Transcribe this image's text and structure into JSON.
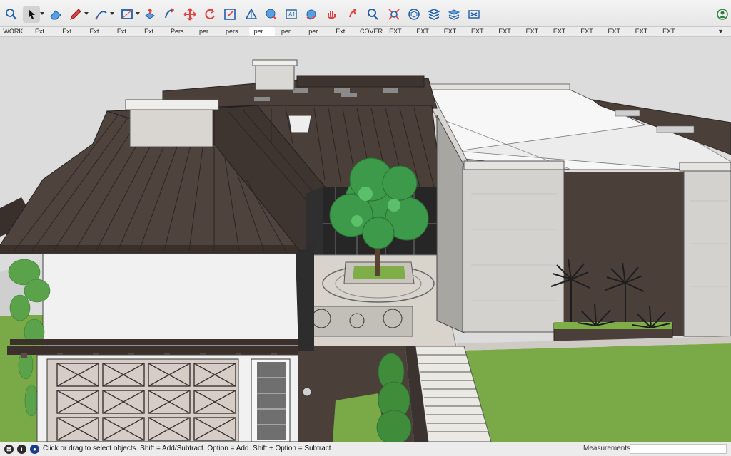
{
  "toolbar": {
    "tools": [
      {
        "name": "search-icon",
        "label": "Search"
      },
      {
        "name": "select-arrow-icon",
        "label": "Select",
        "active": true,
        "menu": true
      },
      {
        "name": "eraser-icon",
        "label": "Eraser"
      },
      {
        "name": "pencil-icon",
        "label": "Line",
        "menu": true
      },
      {
        "name": "arc-icon",
        "label": "Arc",
        "menu": true
      },
      {
        "name": "rectangle-icon",
        "label": "Rectangle",
        "menu": true
      },
      {
        "name": "push-pull-icon",
        "label": "Push/Pull"
      },
      {
        "name": "follow-me-icon",
        "label": "Follow Me"
      },
      {
        "name": "move-icon",
        "label": "Move"
      },
      {
        "name": "rotate-icon",
        "label": "Rotate"
      },
      {
        "name": "scale-icon",
        "label": "Scale"
      },
      {
        "name": "tape-measure-icon",
        "label": "Tape Measure"
      },
      {
        "name": "paint-bucket-icon",
        "label": "Paint Bucket"
      },
      {
        "name": "text-icon",
        "label": "Text"
      },
      {
        "name": "orbit-icon",
        "label": "Orbit"
      },
      {
        "name": "pan-icon",
        "label": "Pan"
      },
      {
        "name": "walk-icon",
        "label": "Walk"
      },
      {
        "name": "zoom-icon",
        "label": "Zoom"
      },
      {
        "name": "zoom-extents-icon",
        "label": "Zoom Extents"
      },
      {
        "name": "3d-warehouse-icon",
        "label": "3D Warehouse"
      },
      {
        "name": "extension-warehouse-icon",
        "label": "Extension Warehouse"
      },
      {
        "name": "layers-icon",
        "label": "Tags"
      },
      {
        "name": "layout-icon",
        "label": "Send to LayOut"
      }
    ],
    "account_icon": "user-account-icon"
  },
  "scene_tabs": [
    "WORK...",
    "Ext....",
    "Ext....",
    "Ext....",
    "Ext....",
    "Ext....",
    "Pers...",
    "per....",
    "pers...",
    "per....",
    "per....",
    "per....",
    "Ext....",
    "COVER",
    "EXT....",
    "EXT....",
    "EXT....",
    "EXT....",
    "EXT....",
    "EXT....",
    "EXT....",
    "EXT....",
    "EXT....",
    "EXT....",
    "EXT...."
  ],
  "selected_tab_index": 9,
  "tabs_more_glyph": "▼",
  "statusbar": {
    "icons": [
      {
        "name": "geolocation-icon",
        "glyph": "⊠",
        "color": "#2a2a2a"
      },
      {
        "name": "credits-icon",
        "glyph": "i",
        "color": "#2a2a2a"
      },
      {
        "name": "user-icon",
        "glyph": "●",
        "color": "#1e3c8c"
      }
    ],
    "message": "Click or drag to select objects. Shift = Add/Subtract. Option = Add. Shift + Option = Subtract.",
    "measurements_label": "Measurements",
    "measurements_value": ""
  },
  "colors": {
    "roof": "#4a3f39",
    "wall_white": "#f1f1f1",
    "stone": "#d4d2cf",
    "grass": "#79aa47",
    "sky": "#dcdcdc",
    "tree": "#3c9a4a"
  }
}
